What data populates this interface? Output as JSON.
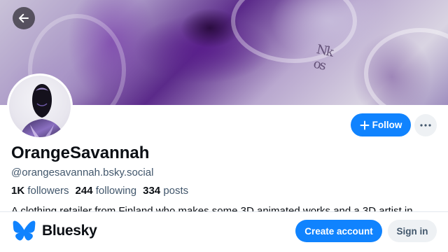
{
  "profile": {
    "display_name": "OrangeSavannah",
    "handle": "@orangesavannah.bsky.social",
    "bio_preview": "A clothing retailer from Finland who makes some 3D animated works and a 3D artist in...",
    "stats": {
      "followers_count": "1K",
      "followers_label": "followers",
      "following_count": "244",
      "following_label": "following",
      "posts_count": "334",
      "posts_label": "posts"
    }
  },
  "actions": {
    "follow_label": "Follow"
  },
  "footer": {
    "brand_name": "Bluesky",
    "create_account_label": "Create account",
    "sign_in_label": "Sign in"
  },
  "colors": {
    "accent": "#1083fe",
    "muted_text": "#42576c",
    "button_bg_secondary": "#eef1f4"
  },
  "icons": {
    "back": "arrow-left-icon",
    "follow": "plus-icon",
    "more": "ellipsis-icon",
    "logo": "butterfly-icon"
  }
}
